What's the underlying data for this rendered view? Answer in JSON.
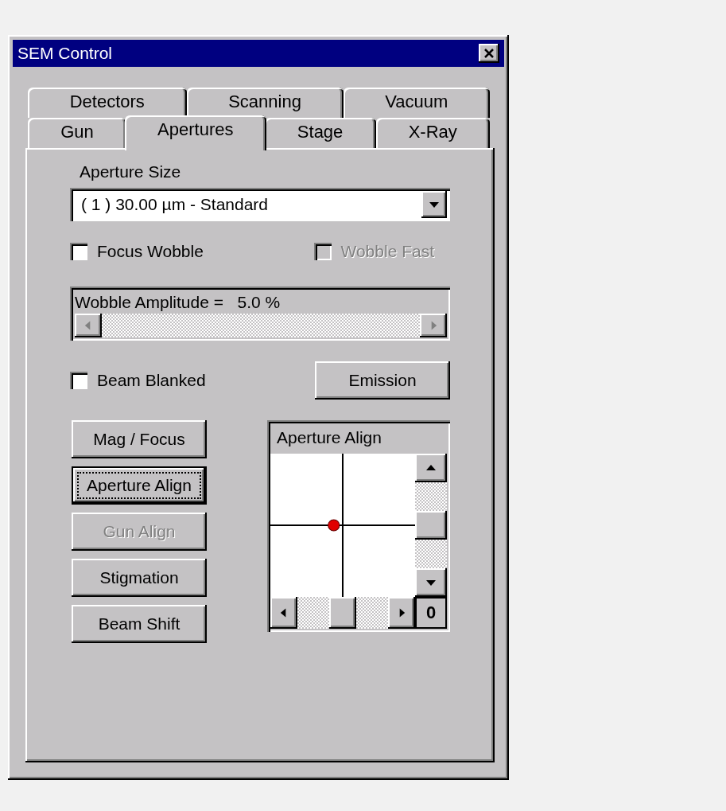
{
  "window": {
    "title": "SEM Control"
  },
  "tab_rows": [
    {
      "tabs": [
        {
          "label": "Detectors",
          "selected": false
        },
        {
          "label": "Scanning",
          "selected": false
        },
        {
          "label": "Vacuum",
          "selected": false
        }
      ]
    },
    {
      "tabs": [
        {
          "label": "Gun",
          "selected": false
        },
        {
          "label": "Apertures",
          "selected": true
        },
        {
          "label": "Stage",
          "selected": false
        },
        {
          "label": "X-Ray",
          "selected": false
        }
      ]
    }
  ],
  "aperture_size": {
    "label": "Aperture Size",
    "value": "( 1 ) 30.00 µm - Standard"
  },
  "wobble_checks": [
    {
      "label": "Focus Wobble",
      "checked": false,
      "disabled": false
    },
    {
      "label": "Wobble Fast",
      "checked": false,
      "disabled": true
    }
  ],
  "wobble_amplitude": {
    "label": "Wobble Amplitude =",
    "reading": "5.0 %"
  },
  "beam_blanked": {
    "label": "Beam Blanked",
    "checked": false,
    "disabled": false
  },
  "emission_button": {
    "label": "Emission"
  },
  "buttons": [
    {
      "label": "Mag / Focus",
      "focused": false,
      "disabled": false
    },
    {
      "label": "Aperture Align",
      "focused": true,
      "disabled": false
    },
    {
      "label": "Gun Align",
      "focused": false,
      "disabled": true
    },
    {
      "label": "Stigmation",
      "focused": false,
      "disabled": false
    },
    {
      "label": "Beam Shift",
      "focused": false,
      "disabled": false
    }
  ],
  "align_pad": {
    "title": "Aperture Align",
    "counter": "0"
  }
}
